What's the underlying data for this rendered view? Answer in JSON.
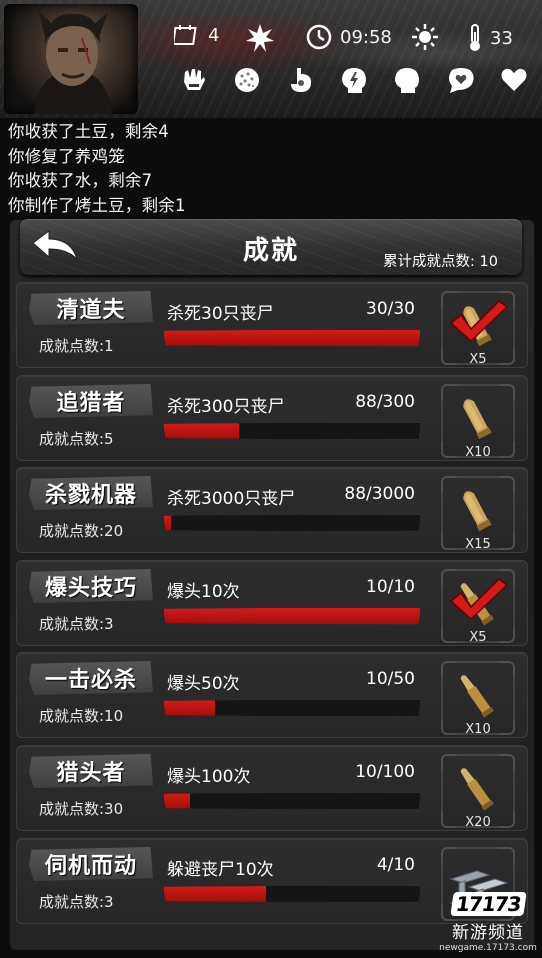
{
  "hud": {
    "day_icon": "calendar-icon",
    "days": "4",
    "weather_icon": "starburst-icon",
    "time_icon": "clock-icon",
    "time": "09:58",
    "sun_icon": "sun-icon",
    "temp_icon": "thermometer-icon",
    "temperature": "33",
    "status_icons": [
      "fist-icon",
      "brain-icon",
      "stomach-icon",
      "lightning-head-icon",
      "head-icon",
      "heart-bubble-icon",
      "heart-icon"
    ]
  },
  "log": [
    "你收获了土豆，剩余4",
    "你修复了养鸡笼",
    "你收获了水，剩余7",
    "你制作了烤土豆，剩余1"
  ],
  "panel": {
    "title": "成就",
    "total_points_label": "累计成就点数: 10"
  },
  "achievements": [
    {
      "name": "清道夫",
      "points": "成就点数:1",
      "goal": "杀死30只丧尸",
      "progress": "30/30",
      "fraction": 1.0,
      "reward": "X5",
      "reward_icon": "bullet-icon",
      "completed": true
    },
    {
      "name": "追猎者",
      "points": "成就点数:5",
      "goal": "杀死300只丧尸",
      "progress": "88/300",
      "fraction": 0.293,
      "reward": "X10",
      "reward_icon": "bullet-icon",
      "completed": false
    },
    {
      "name": "杀戮机器",
      "points": "成就点数:20",
      "goal": "杀死3000只丧尸",
      "progress": "88/3000",
      "fraction": 0.029,
      "reward": "X15",
      "reward_icon": "bullet-icon",
      "completed": false
    },
    {
      "name": "爆头技巧",
      "points": "成就点数:3",
      "goal": "爆头10次",
      "progress": "10/10",
      "fraction": 1.0,
      "reward": "X5",
      "reward_icon": "rifle-bullet-icon",
      "completed": true
    },
    {
      "name": "一击必杀",
      "points": "成就点数:10",
      "goal": "爆头50次",
      "progress": "10/50",
      "fraction": 0.2,
      "reward": "X10",
      "reward_icon": "rifle-bullet-icon",
      "completed": false
    },
    {
      "name": "猎头者",
      "points": "成就点数:30",
      "goal": "爆头100次",
      "progress": "10/100",
      "fraction": 0.1,
      "reward": "X20",
      "reward_icon": "rifle-bullet-icon",
      "completed": false
    },
    {
      "name": "伺机而动",
      "points": "成就点数:3",
      "goal": "躲避丧尸10次",
      "progress": "4/10",
      "fraction": 0.4,
      "reward": "",
      "reward_icon": "steel-beam-icon",
      "completed": false
    }
  ],
  "watermark": {
    "logo": "17173",
    "subtitle": "新游频道",
    "url": "newgame.17173.com"
  },
  "colors": {
    "progress_red": "#c41414",
    "check_red": "#d11a1a",
    "background": "#0d0d0d"
  }
}
